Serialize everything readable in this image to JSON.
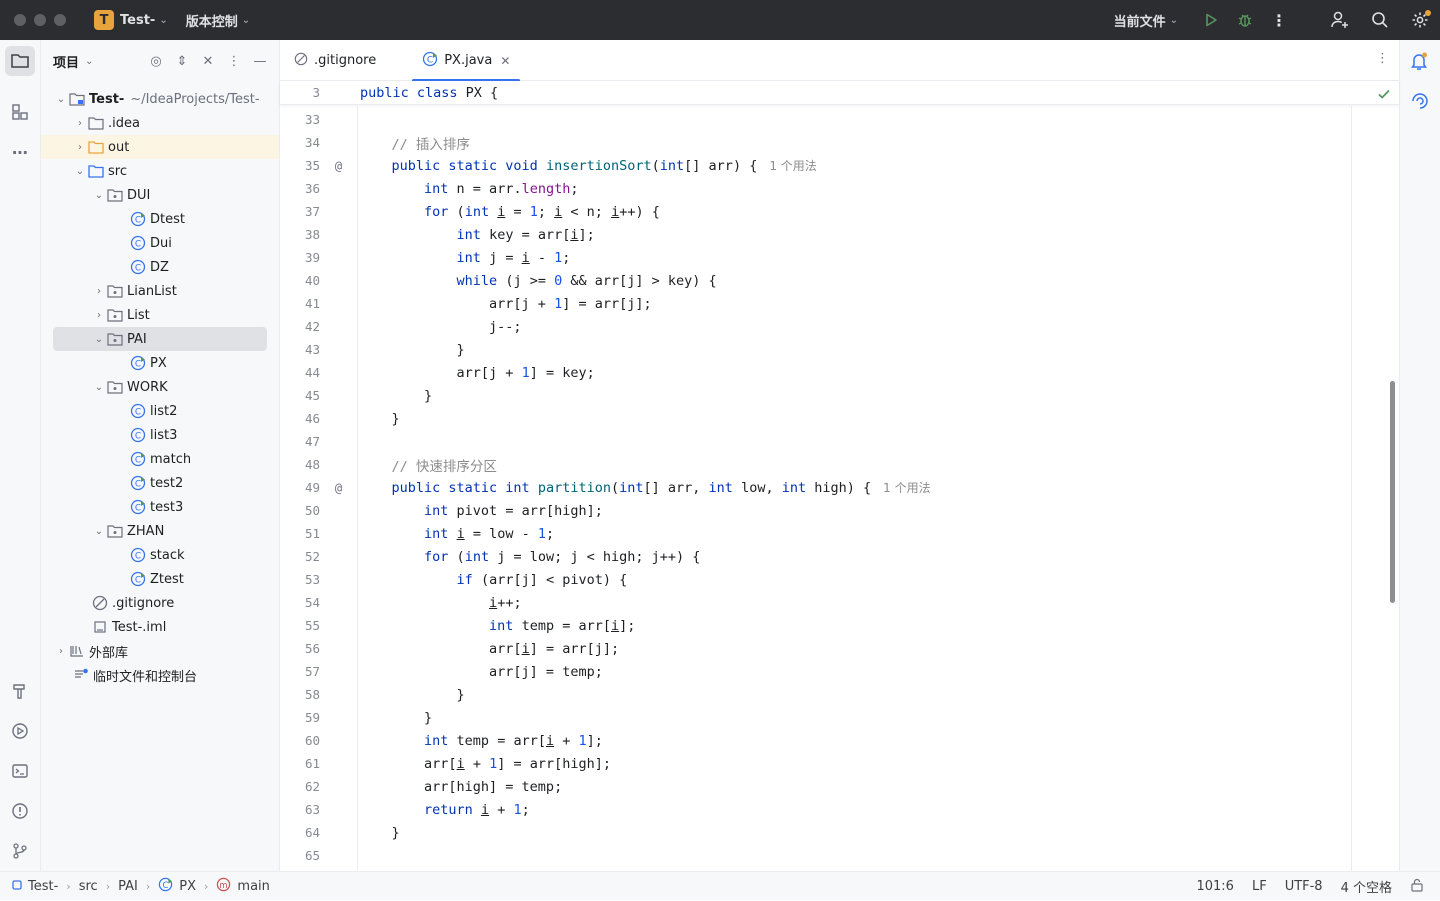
{
  "titlebar": {
    "project_badge": "T",
    "project_name": "Test-",
    "vcs_label": "版本控制",
    "run_config": "当前文件"
  },
  "project_panel": {
    "title": "项目",
    "tree": [
      {
        "label": "Test-",
        "path": "~/IdeaProjects/Test-"
      },
      {
        "label": ".idea"
      },
      {
        "label": "out"
      },
      {
        "label": "src"
      },
      {
        "label": "DUI"
      },
      {
        "label": "Dtest"
      },
      {
        "label": "Dui"
      },
      {
        "label": "DZ"
      },
      {
        "label": "LianList"
      },
      {
        "label": "List"
      },
      {
        "label": "PAI"
      },
      {
        "label": "PX"
      },
      {
        "label": "WORK"
      },
      {
        "label": "list2"
      },
      {
        "label": "list3"
      },
      {
        "label": "match"
      },
      {
        "label": "test2"
      },
      {
        "label": "test3"
      },
      {
        "label": "ZHAN"
      },
      {
        "label": "stack"
      },
      {
        "label": "Ztest"
      },
      {
        "label": ".gitignore"
      },
      {
        "label": "Test-.iml"
      },
      {
        "label": "外部库"
      },
      {
        "label": "临时文件和控制台"
      }
    ]
  },
  "tabs": [
    {
      "label": ".gitignore"
    },
    {
      "label": "PX.java"
    }
  ],
  "sticky": {
    "num": "3",
    "code": "public class PX {"
  },
  "code": {
    "usage_hint": "1 个用法",
    "lines": [
      {
        "num": "33",
        "html": ""
      },
      {
        "num": "34",
        "html": "    <span class=\"cm\">// 插入排序</span>"
      },
      {
        "num": "35",
        "html": "    <span class=\"kw\">public static void</span> <span class=\"fn\">insertionSort</span>(<span class=\"kw\">int</span>[] arr) {"
      },
      {
        "num": "36",
        "html": "        <span class=\"kw\">int</span> n = arr.<span class=\"fld\">length</span>;"
      },
      {
        "num": "37",
        "html": "        <span class=\"kw\">for</span> (<span class=\"kw\">int</span> <span class=\"ul\">i</span> = <span class=\"nu\">1</span>; <span class=\"ul\">i</span> &lt; n; <span class=\"ul\">i</span>++) {"
      },
      {
        "num": "38",
        "html": "            <span class=\"kw\">int</span> key = arr[<span class=\"ul\">i</span>];"
      },
      {
        "num": "39",
        "html": "            <span class=\"kw\">int</span> j = <span class=\"ul\">i</span> - <span class=\"nu\">1</span>;"
      },
      {
        "num": "40",
        "html": "            <span class=\"kw\">while</span> (j &gt;= <span class=\"nu\">0</span> &amp;&amp; arr[j] &gt; key) {"
      },
      {
        "num": "41",
        "html": "                arr[j + <span class=\"nu\">1</span>] = arr[j];"
      },
      {
        "num": "42",
        "html": "                j--;"
      },
      {
        "num": "43",
        "html": "            }"
      },
      {
        "num": "44",
        "html": "            arr[j + <span class=\"nu\">1</span>] = key;"
      },
      {
        "num": "45",
        "html": "        }"
      },
      {
        "num": "46",
        "html": "    }"
      },
      {
        "num": "47",
        "html": ""
      },
      {
        "num": "48",
        "html": "    <span class=\"cm\">// 快速排序分区</span>"
      },
      {
        "num": "49",
        "html": "    <span class=\"kw\">public static int</span> <span class=\"fn\">partition</span>(<span class=\"kw\">int</span>[] arr, <span class=\"kw\">int</span> low, <span class=\"kw\">int</span> high) {"
      },
      {
        "num": "50",
        "html": "        <span class=\"kw\">int</span> pivot = arr[high];"
      },
      {
        "num": "51",
        "html": "        <span class=\"kw\">int</span> <span class=\"ul\">i</span> = low - <span class=\"nu\">1</span>;"
      },
      {
        "num": "52",
        "html": "        <span class=\"kw\">for</span> (<span class=\"kw\">int</span> j = low; j &lt; high; j++) {"
      },
      {
        "num": "53",
        "html": "            <span class=\"kw\">if</span> (arr[j] &lt; pivot) {"
      },
      {
        "num": "54",
        "html": "                <span class=\"ul\">i</span>++;"
      },
      {
        "num": "55",
        "html": "                <span class=\"kw\">int</span> temp = arr[<span class=\"ul\">i</span>];"
      },
      {
        "num": "56",
        "html": "                arr[<span class=\"ul\">i</span>] = arr[j];"
      },
      {
        "num": "57",
        "html": "                arr[j] = temp;"
      },
      {
        "num": "58",
        "html": "            }"
      },
      {
        "num": "59",
        "html": "        }"
      },
      {
        "num": "60",
        "html": "        <span class=\"kw\">int</span> temp = arr[<span class=\"ul\">i</span> + <span class=\"nu\">1</span>];"
      },
      {
        "num": "61",
        "html": "        arr[<span class=\"ul\">i</span> + <span class=\"nu\">1</span>] = arr[high];"
      },
      {
        "num": "62",
        "html": "        arr[high] = temp;"
      },
      {
        "num": "63",
        "html": "        <span class=\"kw\">return</span> <span class=\"ul\">i</span> + <span class=\"nu\">1</span>;"
      },
      {
        "num": "64",
        "html": "    }"
      },
      {
        "num": "65",
        "html": ""
      }
    ]
  },
  "statusbar": {
    "crumbs": [
      "Test-",
      "src",
      "PAI",
      "PX",
      "main"
    ],
    "position": "101:6",
    "line_sep": "LF",
    "encoding": "UTF-8",
    "indent": "4 个空格"
  },
  "colors": {
    "accent": "#3574f0",
    "run": "#57965c",
    "badge": "#e8a33d"
  }
}
